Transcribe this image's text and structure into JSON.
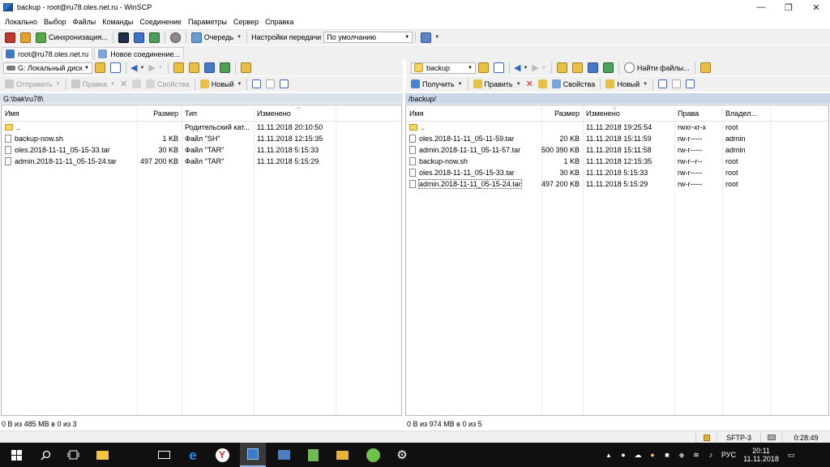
{
  "window": {
    "title": "backup - root@ru78.oles.net.ru - WinSCP",
    "minimize_glyph": "—",
    "maximize_glyph": "❐",
    "close_glyph": "✕"
  },
  "menu": [
    "Локально",
    "Выбор",
    "Файлы",
    "Команды",
    "Соединение",
    "Параметры",
    "Сервер",
    "Справка"
  ],
  "toolbar": {
    "sync_label": "Синхронизация...",
    "queue_label": "Очередь",
    "transfer_label": "Настройки передачи",
    "transfer_value": "По умолчанию"
  },
  "tabs": {
    "session": "root@ru78.oles.net.ru",
    "new_session": "Новое соединение..."
  },
  "local": {
    "drive": "G: Локальный диск",
    "upload": "Отправить",
    "edit": "Правка",
    "properties": "Свойства",
    "new": "Новый",
    "path": "G:\\bak\\ru78\\",
    "columns": {
      "name": "Имя",
      "size": "Размер",
      "type": "Тип",
      "changed": "Изменено"
    },
    "files": [
      {
        "name": "..",
        "size": "",
        "type": "Родительский кат...",
        "changed": "11.11.2018  20:10:50"
      },
      {
        "name": "backup-now.sh",
        "size": "1 KB",
        "type": "Файл \"SH\"",
        "changed": "11.11.2018  12:15:35"
      },
      {
        "name": "oles.2018-11-11_05-15-33.tar",
        "size": "30 KB",
        "type": "Файл \"TAR\"",
        "changed": "11.11.2018  5:15:33"
      },
      {
        "name": "admin.2018-11-11_05-15-24.tar",
        "size": "497 200 KB",
        "type": "Файл \"TAR\"",
        "changed": "11.11.2018  5:15:29"
      }
    ],
    "status": "0 В из 485 МВ в 0 из 3"
  },
  "remote": {
    "folder": "backup",
    "find_files": "Найти файлы...",
    "download": "Получить",
    "edit": "Править",
    "properties": "Свойства",
    "new": "Новый",
    "path": "/backup/",
    "columns": {
      "name": "Имя",
      "size": "Размер",
      "changed": "Изменено",
      "rights": "Права",
      "owner": "Владел..."
    },
    "files": [
      {
        "name": "..",
        "size": "",
        "changed": "11.11.2018 19:25:54",
        "rights": "rwxr-xr-x",
        "owner": "root"
      },
      {
        "name": "oles.2018-11-11_05-11-59.tar",
        "size": "20 KB",
        "changed": "11.11.2018 15:11:59",
        "rights": "rw-r-----",
        "owner": "admin"
      },
      {
        "name": "admin.2018-11-11_05-11-57.tar",
        "size": "500 390 KB",
        "changed": "11.11.2018 15:11:58",
        "rights": "rw-r-----",
        "owner": "admin"
      },
      {
        "name": "backup-now.sh",
        "size": "1 KB",
        "changed": "11.11.2018 12:15:35",
        "rights": "rw-r--r--",
        "owner": "root"
      },
      {
        "name": "oles.2018-11-11_05-15-33.tar",
        "size": "30 KB",
        "changed": "11.11.2018 5:15:33",
        "rights": "rw-r-----",
        "owner": "root"
      },
      {
        "name": "admin.2018-11-11_05-15-24.tar",
        "size": "497 200 KB",
        "changed": "11.11.2018 5:15:29",
        "rights": "rw-r-----",
        "owner": "root"
      }
    ],
    "status": "0 В из 974 МВ в 0 из 5"
  },
  "statusbar": {
    "protocol": "SFTP-3",
    "elapsed": "0:28:49"
  },
  "taskbar": {
    "time": "20:11",
    "date": "11.11.2018",
    "lang": "РУС"
  },
  "colors": {
    "path_active": "#c9d7e8",
    "taskbar": "#101010",
    "toolbar": "#f0f0f0"
  }
}
